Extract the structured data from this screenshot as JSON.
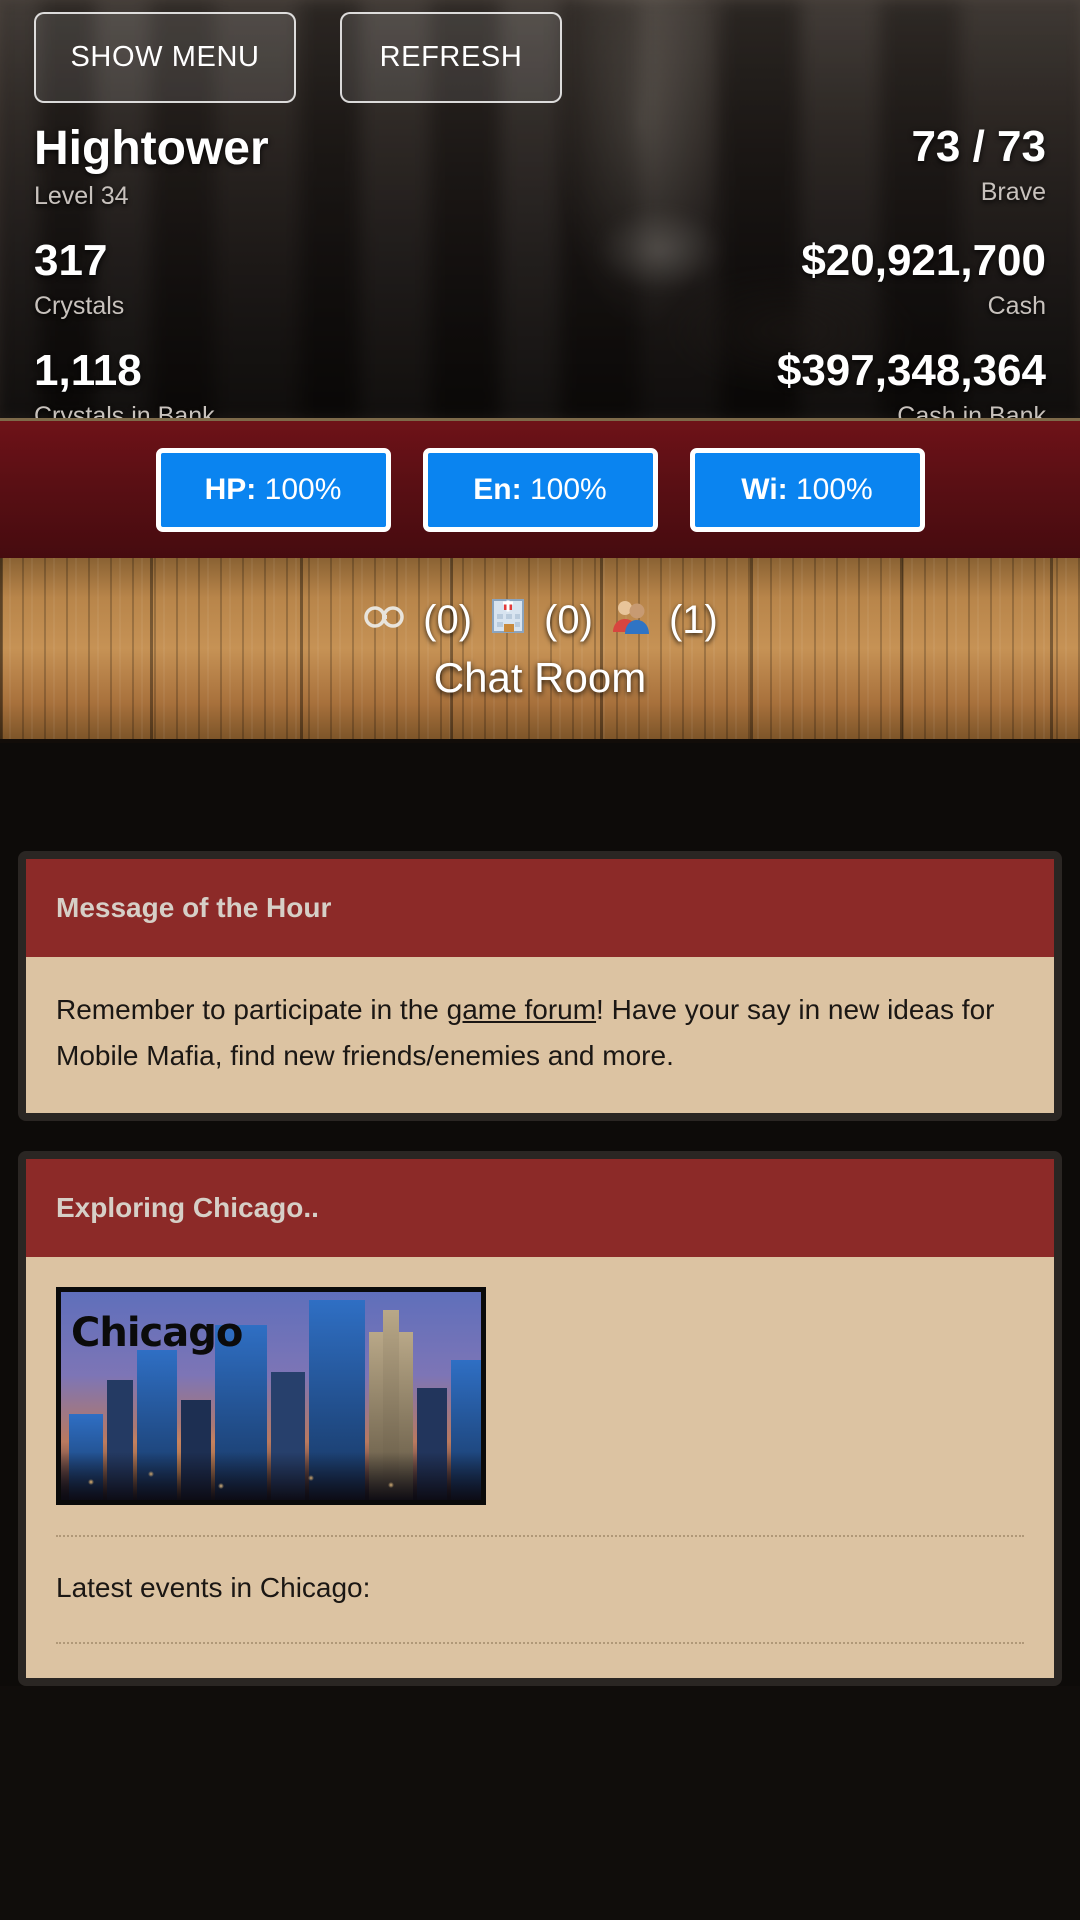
{
  "header": {
    "buttons": {
      "menu": "SHOW MENU",
      "refresh": "REFRESH"
    },
    "player": {
      "name": "Hightower",
      "level": "Level 34"
    },
    "brave": {
      "value": "73 / 73",
      "label": "Brave"
    },
    "crystals": {
      "value": "317",
      "label": "Crystals"
    },
    "cash": {
      "value": "$20,921,700",
      "label": "Cash"
    },
    "crystals_bank": {
      "value": "1,118",
      "label": "Crystals in Bank"
    },
    "cash_bank": {
      "value": "$397,348,364",
      "label": "Cash in Bank"
    }
  },
  "stats_bar": {
    "hp": {
      "label": "HP:",
      "value": "100%"
    },
    "energy": {
      "label": "En:",
      "value": "100%"
    },
    "will": {
      "label": "Wi:",
      "value": "100%"
    }
  },
  "chat_bar": {
    "jail_icon": "handcuffs-icon",
    "jail_glyph": "🔗",
    "jail_count": "(0)",
    "hospital_icon": "hospital-icon",
    "hospital_glyph": "🏥",
    "hospital_count": "(0)",
    "online_icon": "people-icon",
    "online_glyph": "👥",
    "online_count": "(1)",
    "title": "Chat Room"
  },
  "motd": {
    "title": "Message of the Hour",
    "text_before": "Remember to participate in the ",
    "link": "game forum",
    "text_after": "! Have your say in new ideas for Mobile Mafia, find new friends/enemies and more."
  },
  "exploring": {
    "title": "Exploring Chicago..",
    "image_alt": "Chicago",
    "image_wordmark": "Chicago",
    "latest": "Latest events in Chicago:"
  },
  "colors": {
    "accent_red": "#8c2a28",
    "panel_tan": "#dcc3a2",
    "pill_blue": "#0a84f0",
    "bar_red": "#5a0f14"
  }
}
